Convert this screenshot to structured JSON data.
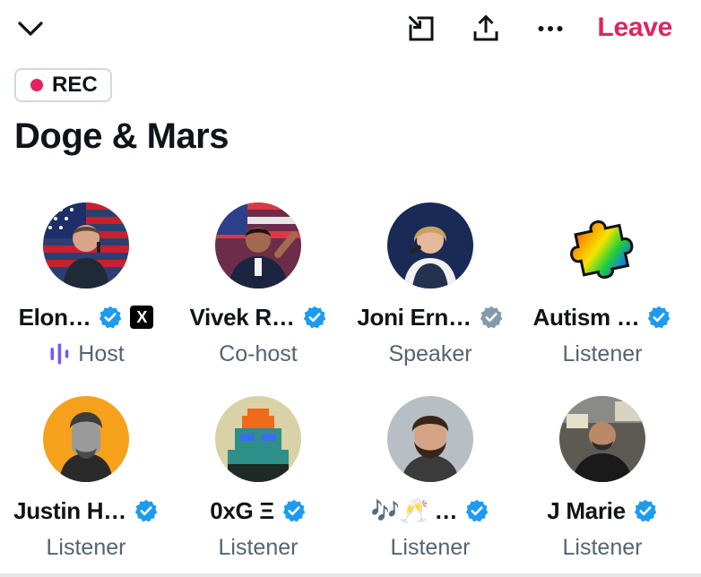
{
  "header": {
    "leave_label": "Leave"
  },
  "rec": {
    "label": "REC",
    "color": "#e0245e"
  },
  "space": {
    "title": "Doge & Mars"
  },
  "colors": {
    "accent_red": "#e0245e",
    "verified_blue": "#1d9bf0",
    "verified_gray": "#829aab",
    "host_purple": "#7856ff",
    "secondary_text": "#536471"
  },
  "participants": [
    {
      "name": "Elon…",
      "role": "Host",
      "badge": "blue",
      "affiliate": "X"
    },
    {
      "name": "Vivek R…",
      "role": "Co-host",
      "badge": "blue"
    },
    {
      "name": "Joni Ern…",
      "role": "Speaker",
      "badge": "gray"
    },
    {
      "name": "Autism …",
      "role": "Listener",
      "badge": "blue"
    },
    {
      "name": "Justin H…",
      "role": "Listener",
      "badge": "blue"
    },
    {
      "name": "0xG Ξ",
      "role": "Listener",
      "badge": "blue"
    },
    {
      "name": "🎶🥂 …",
      "role": "Listener",
      "badge": "blue"
    },
    {
      "name": "J Marie",
      "role": "Listener",
      "badge": "blue"
    }
  ]
}
